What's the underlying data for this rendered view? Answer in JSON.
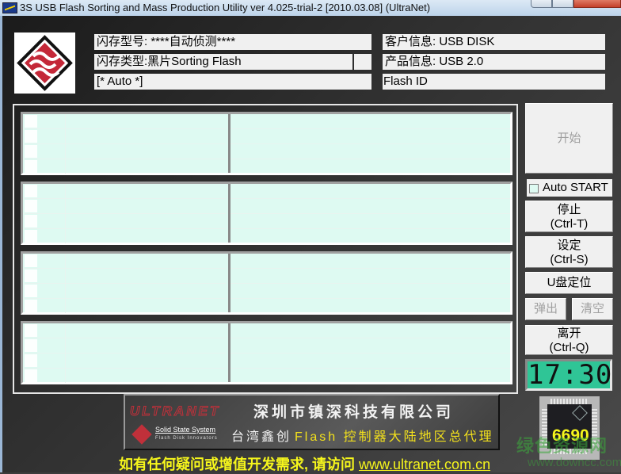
{
  "window": {
    "title": "3S USB Flash Sorting and Mass Production Utility ver 4.025-trial-2 [2010.03.08] (UltraNet)",
    "app_icon": "ultranet-app-icon",
    "controls": [
      "minimize",
      "maximize",
      "close"
    ]
  },
  "info": {
    "flash_model": "闪存型号: ****自动侦测****",
    "flash_type": "闪存类型:黑片Sorting Flash",
    "mode": "[* Auto *]",
    "customer_info": "客户信息: USB DISK",
    "product_info": "产品信息: USB 2.0",
    "flash_id": "Flash ID"
  },
  "slots": {
    "count": 4,
    "rows_per_slot": 4
  },
  "buttons": {
    "start": "开始",
    "auto_start": "Auto START",
    "auto_start_checked": false,
    "stop_line1": "停止",
    "stop_line2": "(Ctrl-T)",
    "settings_line1": "设定",
    "settings_line2": "(Ctrl-S)",
    "locate": "U盘定位",
    "eject": "弹出",
    "clear": "清空",
    "exit_line1": "离开",
    "exit_line2": "(Ctrl-Q)"
  },
  "clock": "17:30",
  "banner": {
    "brand": "ULTRANET",
    "company": "深圳市镇深科技有限公司",
    "sss_name": "Solid State System",
    "sss_tagline": "Flash Disk Innovators",
    "agent_prefix": "台湾鑫创",
    "agent_suffix": "Flash 控制器大陆地区总代理"
  },
  "chip": {
    "model": "6690"
  },
  "watermark": {
    "line1": "绿色资源网",
    "line2": "www.downcc.com"
  },
  "footer": {
    "text": "如有任何疑问或增值开发需求, 请访问 ",
    "link": "www.ultranet.com.cn"
  },
  "colors": {
    "slot_bg": "#defaf2",
    "clock_bg": "#2fc596",
    "footer_text": "#f6f61c",
    "brand_red": "#c0303a"
  }
}
